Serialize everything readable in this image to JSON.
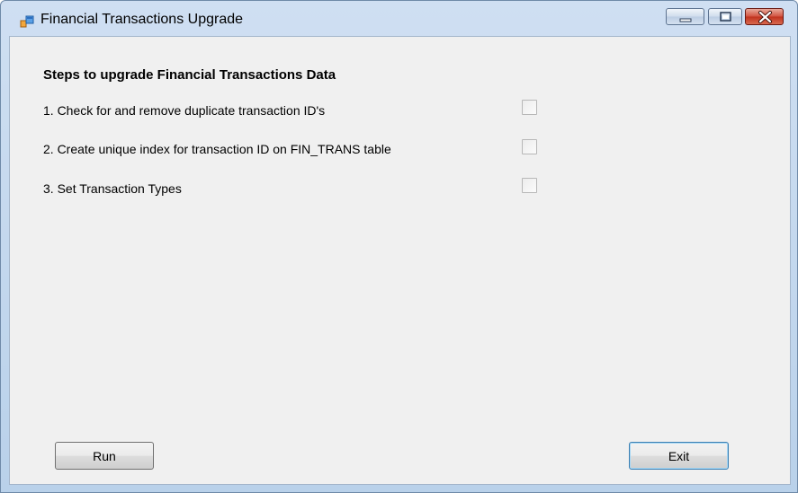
{
  "window": {
    "title": "Financial Transactions Upgrade",
    "app_icon": "form-designer-icon",
    "controls": [
      "minimize-icon",
      "maximize-icon",
      "close-icon"
    ]
  },
  "form": {
    "heading": "Steps to upgrade Financial Transactions Data",
    "steps": [
      {
        "label": "1. Check for and remove duplicate transaction ID's",
        "checked": false
      },
      {
        "label": "2. Create unique index for transaction ID on FIN_TRANS table",
        "checked": false
      },
      {
        "label": "3. Set Transaction Types",
        "checked": false
      }
    ]
  },
  "buttons": {
    "run_label": "Run",
    "exit_label": "Exit"
  },
  "colors": {
    "frame": "#b9d1ea",
    "client": "#f0f0f0",
    "close_button": "#c0321d",
    "focus_border": "#3c7fb1"
  }
}
